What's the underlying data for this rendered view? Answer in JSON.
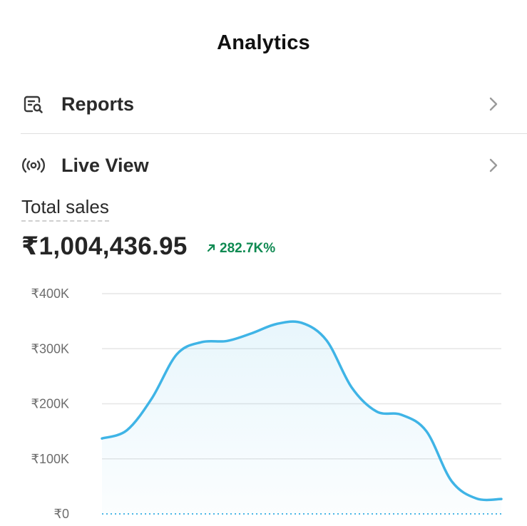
{
  "header": {
    "title": "Analytics"
  },
  "nav": {
    "items": [
      {
        "label": "Reports",
        "icon": "reports-search-icon"
      },
      {
        "label": "Live View",
        "icon": "live-broadcast-icon"
      }
    ]
  },
  "metric": {
    "label": "Total sales",
    "value": "₹1,004,436.95",
    "change": "282.7K%",
    "change_direction": "up",
    "change_color": "#0f8a52"
  },
  "chart_data": {
    "type": "area",
    "title": "",
    "xlabel": "",
    "ylabel": "",
    "ylim": [
      0,
      400000
    ],
    "y_ticks": [
      "₹400K",
      "₹300K",
      "₹200K",
      "₹100K",
      "₹0"
    ],
    "y_tick_values": [
      400000,
      300000,
      200000,
      100000,
      0
    ],
    "grid": true,
    "series": [
      {
        "values": [
          137000,
          152000,
          210000,
          290000,
          312000,
          314000,
          328000,
          345000,
          347000,
          315000,
          230000,
          186000,
          180000,
          150000,
          60000,
          28000,
          27000
        ],
        "color": "#3fb4e6"
      }
    ],
    "baseline_style": "dotted",
    "baseline_color": "#4bb6e6"
  }
}
